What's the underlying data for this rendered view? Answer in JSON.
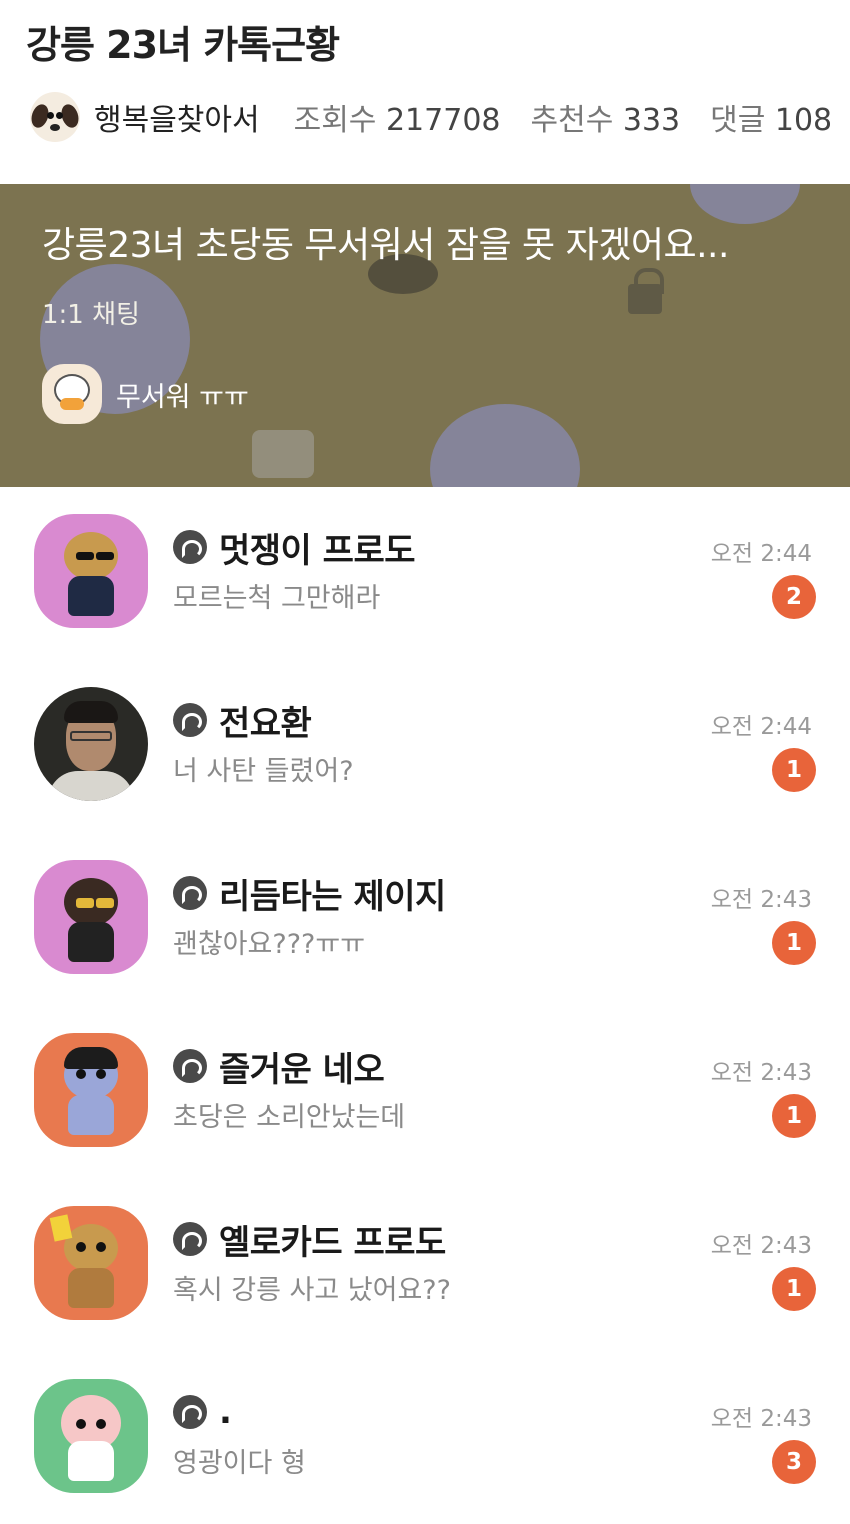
{
  "post": {
    "title": "강릉 23녀 카톡근황",
    "author": "행복을찾아서",
    "views_label": "조회수",
    "views_value": "217708",
    "likes_label": "추천수",
    "likes_value": "333",
    "comments_label": "댓글",
    "comments_value": "108"
  },
  "banner": {
    "title": "강릉23녀 초당동 무서워서 잠을 못 자겠어요...",
    "subtitle": "1:1 채팅",
    "last_message": "무서워 ㅠㅠ",
    "background": "#7c7350"
  },
  "chats": [
    {
      "name": "멋쟁이 프로도",
      "message": "모르는척 그만해라",
      "time": "오전 2:44",
      "unread": "2",
      "avatar_bg": "#d98ad0",
      "avatar_icon": "frodo-avatar-icon"
    },
    {
      "name": "전요환",
      "message": "너 사탄 들렸어?",
      "time": "오전 2:44",
      "unread": "1",
      "avatar_bg": "#2a2a26",
      "avatar_icon": "profile-photo"
    },
    {
      "name": "리듬타는 제이지",
      "message": "괜찮아요???ㅠㅠ",
      "time": "오전 2:43",
      "unread": "1",
      "avatar_bg": "#d98ad0",
      "avatar_icon": "jayg-avatar-icon"
    },
    {
      "name": "즐거운 네오",
      "message": "초당은 소리안났는데",
      "time": "오전 2:43",
      "unread": "1",
      "avatar_bg": "#e8794f",
      "avatar_icon": "neo-avatar-icon"
    },
    {
      "name": "옐로카드 프로도",
      "message": "혹시 강릉 사고 났어요??",
      "time": "오전 2:43",
      "unread": "1",
      "avatar_bg": "#e8794f",
      "avatar_icon": "frodo-avatar-icon"
    },
    {
      "name": ".",
      "message": "영광이다 형",
      "time": "오전 2:43",
      "unread": "3",
      "avatar_bg": "#6cc48a",
      "avatar_icon": "apeach-avatar-icon"
    }
  ],
  "colors": {
    "badge": "#e8643a",
    "open_chat_icon": "#4a4a4a"
  }
}
